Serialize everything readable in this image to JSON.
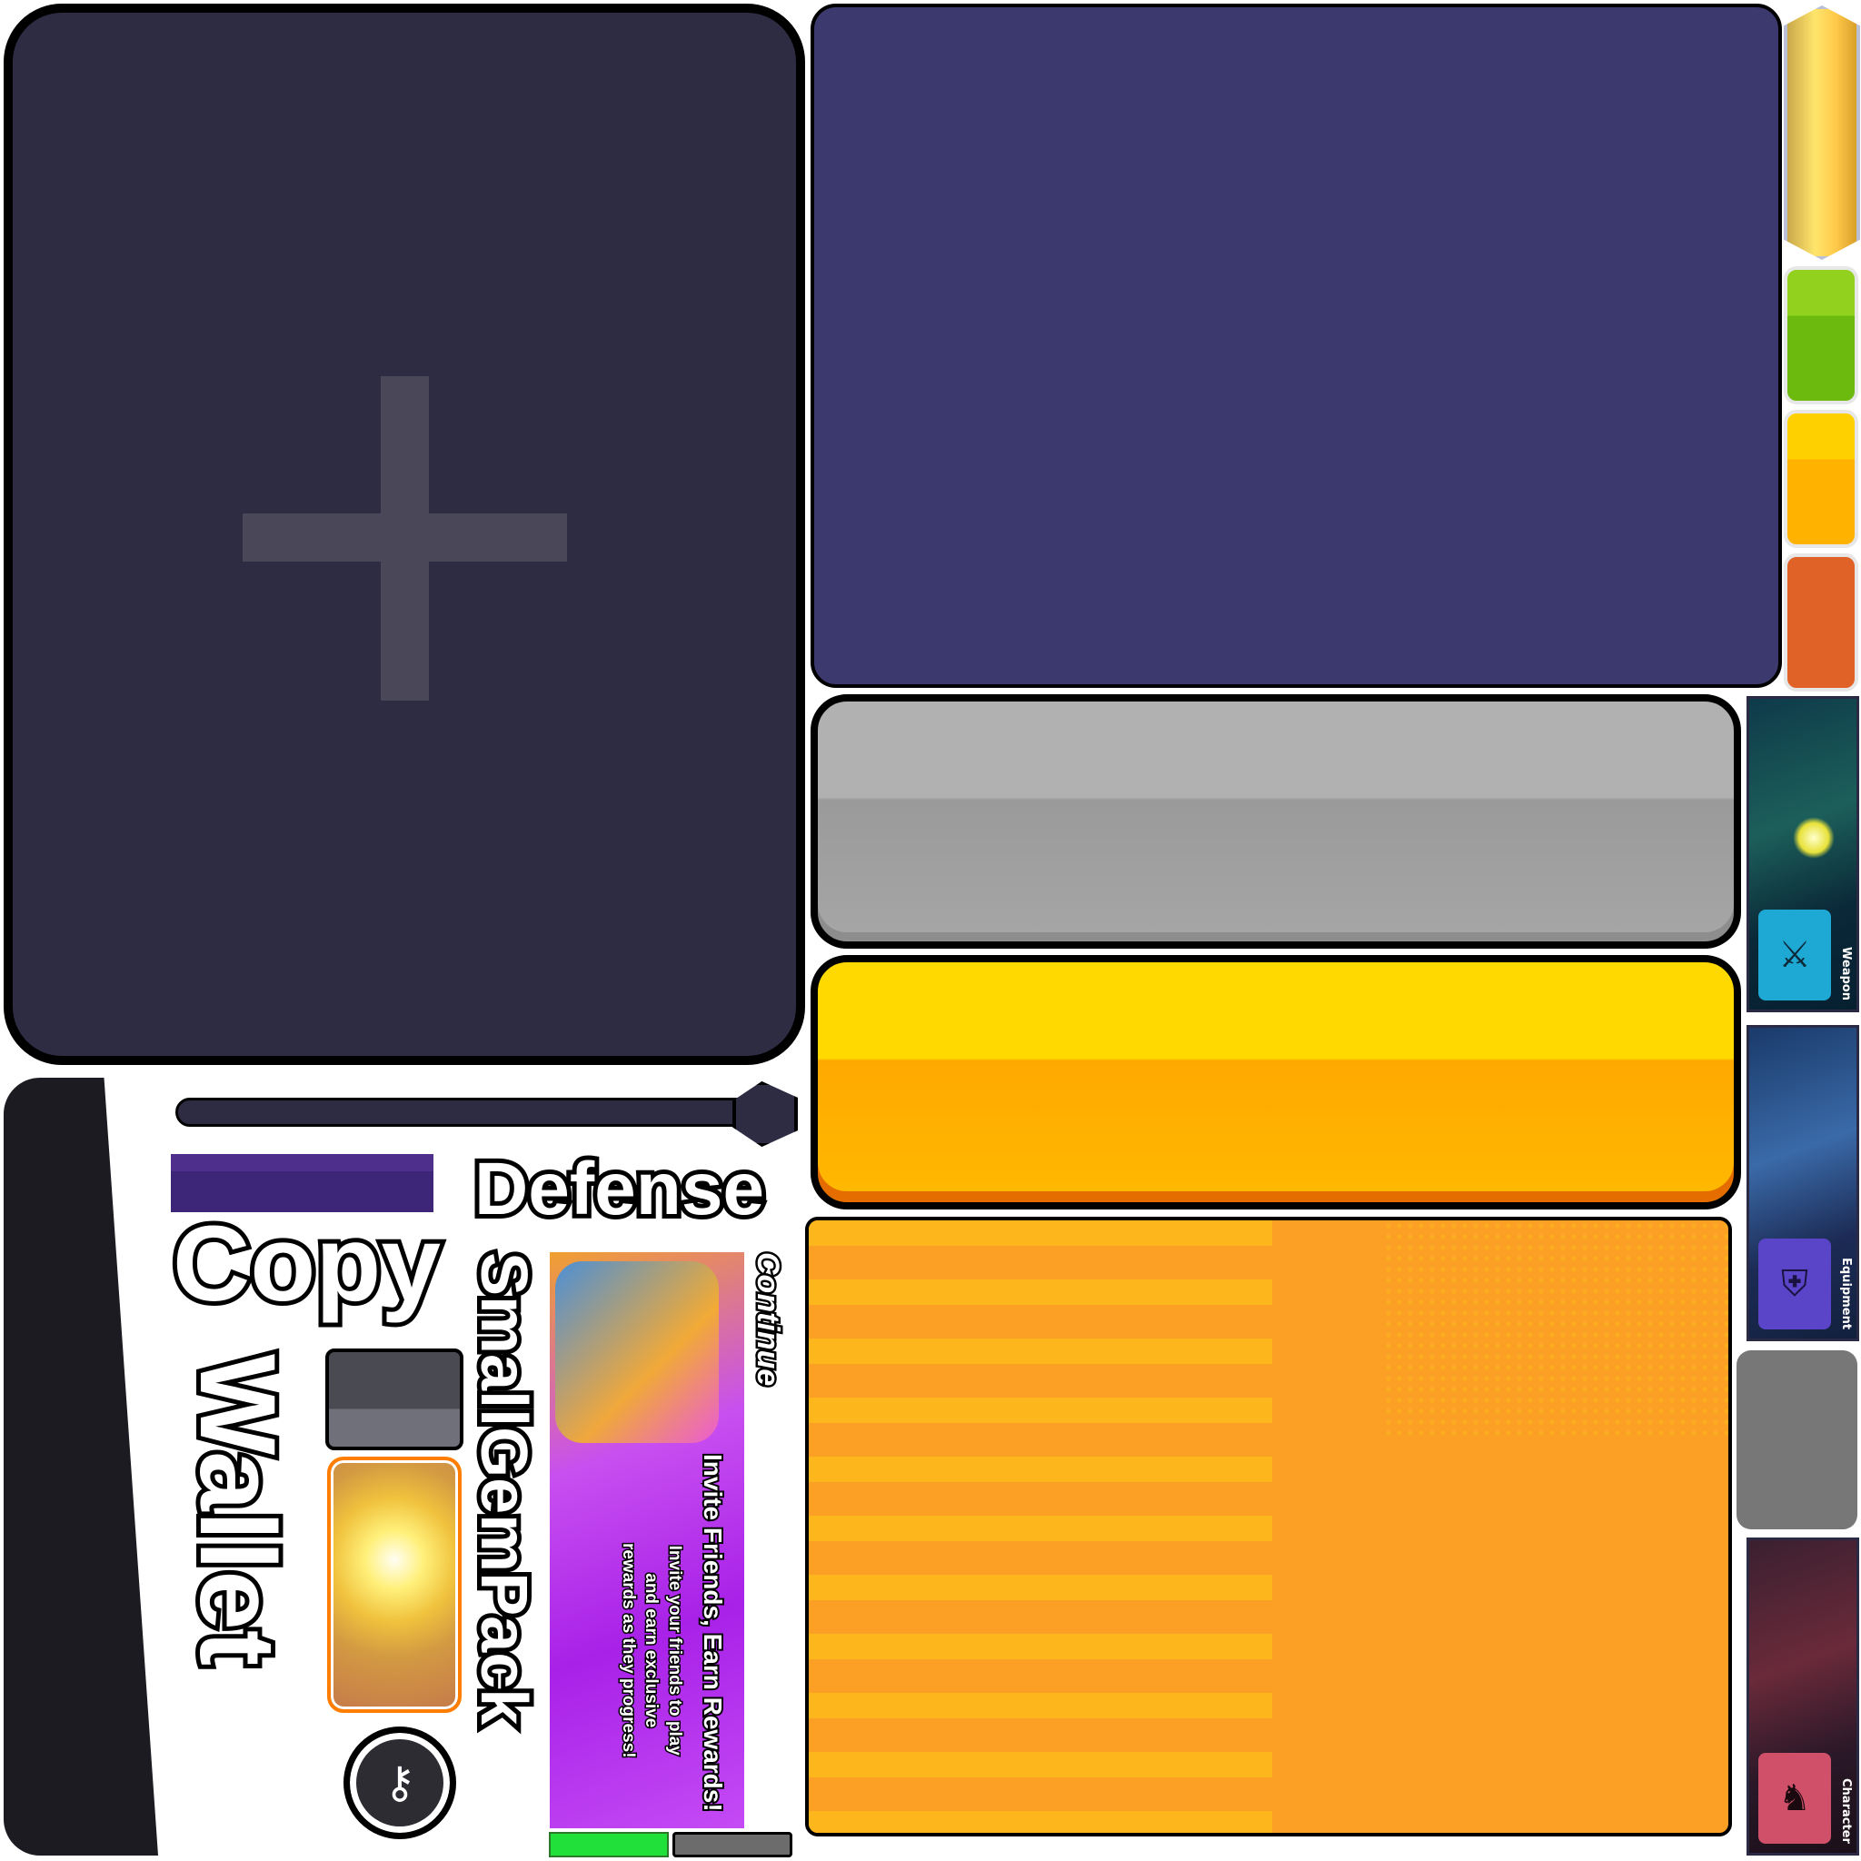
{
  "labels": {
    "copy": "Copy",
    "wallet": "Wallet",
    "defense": "Defense",
    "small_gem_pack": "SmallGemPack",
    "continue": "Continue"
  },
  "promo": {
    "title": "Invite Friends, Earn Rewards!",
    "body_line1": "Invite your friends to play",
    "body_line2": "and earn exclusive",
    "body_line3": "rewards as they progress!"
  },
  "tabs": {
    "weapon": "Weapon",
    "equipment": "Equipment",
    "character": "Character"
  },
  "icons": {
    "add": "plus-icon",
    "key": "key-icon",
    "weapon": "sword-icon",
    "equipment": "helmet-icon",
    "character": "silhouette-icon"
  },
  "colors": {
    "panel_dark": "#2d2c43",
    "panel_indigo": "#3b396d",
    "button_gray": "#b1b1b1",
    "button_yellow": "#ffd900",
    "panel_orange": "#fba024",
    "slot_green": "#7ac814",
    "slot_yellow": "#ffb700",
    "slot_orange": "#e06226",
    "progress_green": "#22e03a"
  }
}
